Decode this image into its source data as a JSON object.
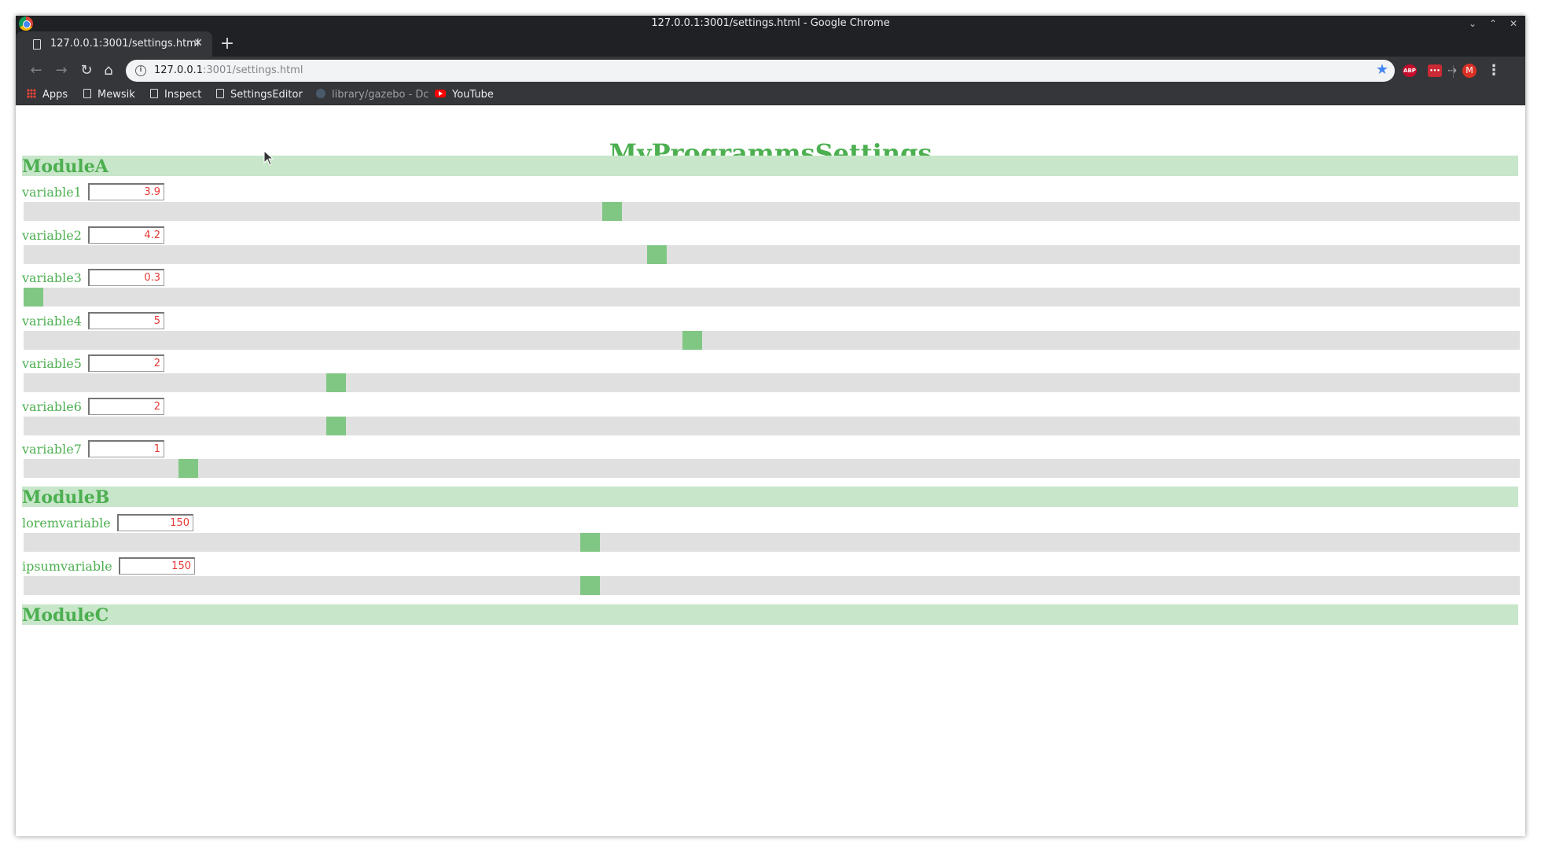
{
  "window": {
    "title": "127.0.0.1:3001/settings.html - Google Chrome"
  },
  "tab": {
    "title": "127.0.0.1:3001/settings.html",
    "close": "✕"
  },
  "newtab": "+",
  "omnibox": {
    "host": "127.0.0.1",
    "path": ":3001/settings.html"
  },
  "bookmarks": [
    {
      "label": "Apps",
      "icon": "apps-grid-icon"
    },
    {
      "label": "Mewsik",
      "icon": "page-icon"
    },
    {
      "label": "Inspect",
      "icon": "page-icon"
    },
    {
      "label": "SettingsEditor",
      "icon": "page-icon"
    },
    {
      "label": "library/gazebo - Dc",
      "icon": "gazebo-icon"
    },
    {
      "label": "YouTube",
      "icon": "youtube-icon"
    }
  ],
  "extensions": {
    "abp": "ABP",
    "lastpass": "•••",
    "avatar": "M"
  },
  "colors": {
    "accent": "#4caf50",
    "header_bg": "#c8e6c9",
    "track": "#e0e0e0",
    "thumb": "#81c784",
    "value": "#e53935"
  },
  "page": {
    "title": "MyProgrammsSettings",
    "modules": [
      {
        "name": "ModuleA",
        "variables": [
          {
            "label": "variable1",
            "value": "3.9",
            "position": 0.392
          },
          {
            "label": "variable2",
            "value": "4.2",
            "position": 0.422
          },
          {
            "label": "variable3",
            "value": "0.3",
            "position": 0.0
          },
          {
            "label": "variable4",
            "value": "5",
            "position": 0.446
          },
          {
            "label": "variable5",
            "value": "2",
            "position": 0.205
          },
          {
            "label": "variable6",
            "value": "2",
            "position": 0.205
          },
          {
            "label": "variable7",
            "value": "1",
            "position": 0.105
          }
        ]
      },
      {
        "name": "ModuleB",
        "variables": [
          {
            "label": "loremvariable",
            "value": "150",
            "position": 0.377
          },
          {
            "label": "ipsumvariable",
            "value": "150",
            "position": 0.377
          }
        ]
      },
      {
        "name": "ModuleC",
        "variables": []
      }
    ]
  }
}
